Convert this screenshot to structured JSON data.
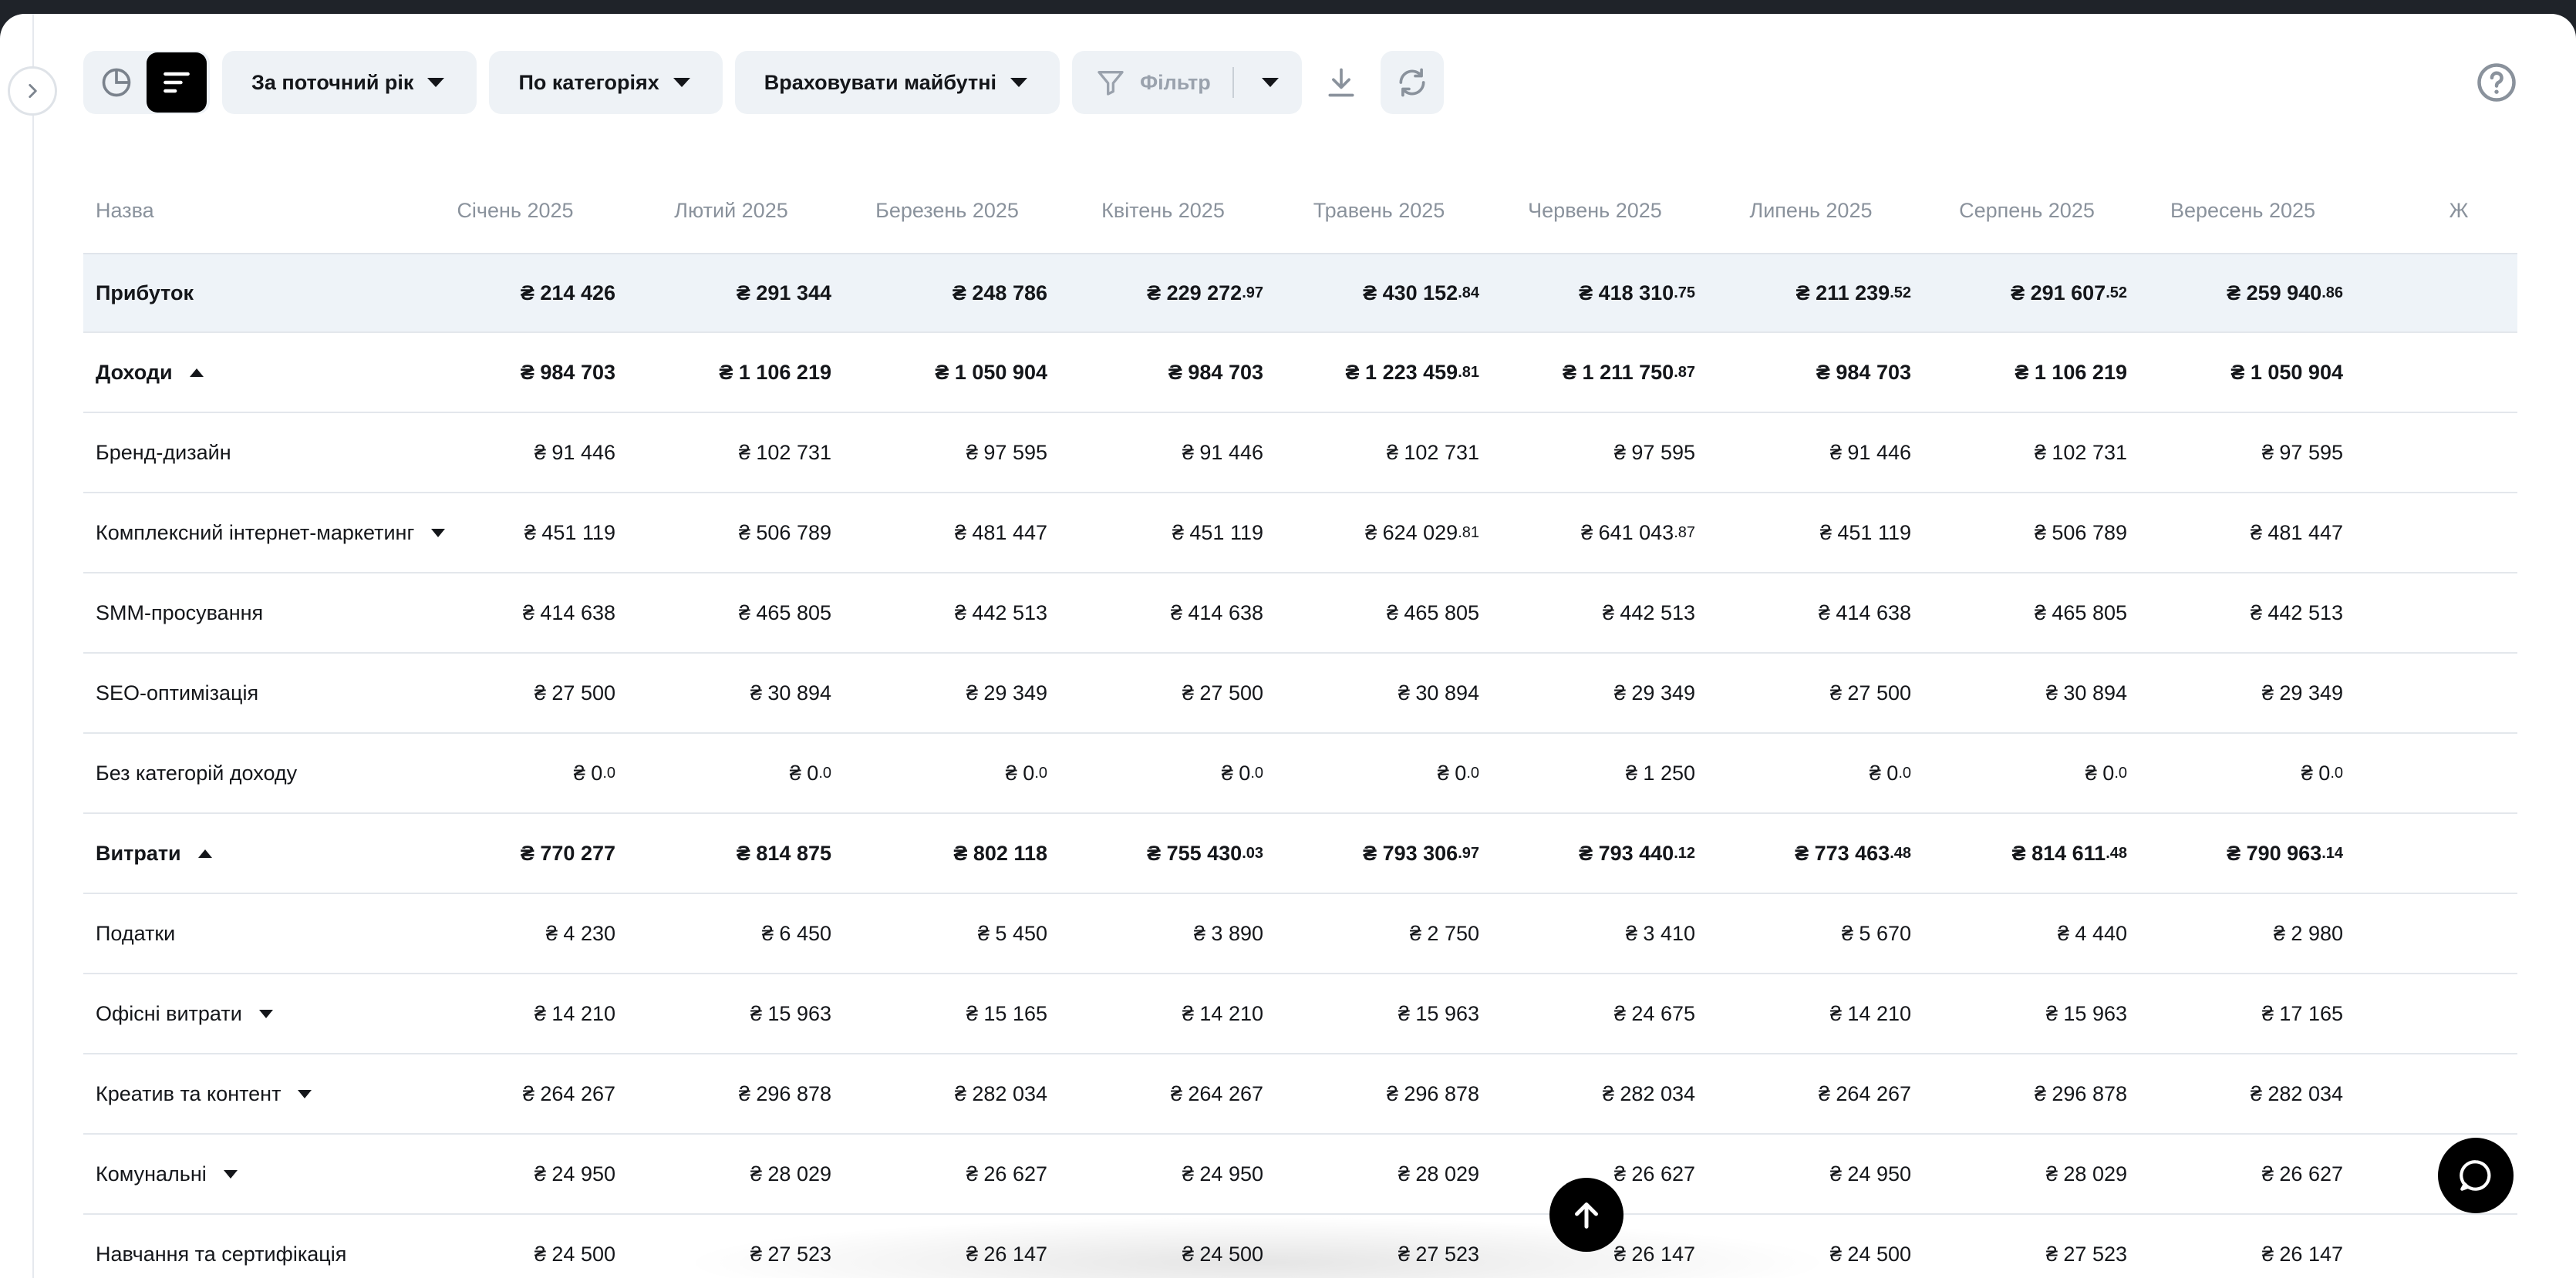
{
  "toolbar": {
    "period_label": "За поточний рік",
    "group_label": "По категоріях",
    "future_label": "Враховувати майбутні",
    "filter_label": "Фільтр"
  },
  "table": {
    "columns": [
      "Назва",
      "Січень 2025",
      "Лютий 2025",
      "Березень 2025",
      "Квітень 2025",
      "Травень 2025",
      "Червень 2025",
      "Липень 2025",
      "Серпень 2025",
      "Вересень 2025",
      "Ж"
    ],
    "rows": [
      {
        "name": "Прибуток",
        "bold": true,
        "profit": true,
        "toggle": "",
        "values": [
          [
            "₴ 214 426",
            ""
          ],
          [
            "₴ 291 344",
            ""
          ],
          [
            "₴ 248 786",
            ""
          ],
          [
            "₴ 229 272",
            ".97"
          ],
          [
            "₴ 430 152",
            ".84"
          ],
          [
            "₴ 418 310",
            ".75"
          ],
          [
            "₴ 211 239",
            ".52"
          ],
          [
            "₴ 291 607",
            ".52"
          ],
          [
            "₴ 259 940",
            ".86"
          ],
          [
            "₴",
            ""
          ]
        ]
      },
      {
        "name": "Доходи",
        "bold": true,
        "toggle": "up",
        "values": [
          [
            "₴ 984 703",
            ""
          ],
          [
            "₴ 1 106 219",
            ""
          ],
          [
            "₴ 1 050 904",
            ""
          ],
          [
            "₴ 984 703",
            ""
          ],
          [
            "₴ 1 223 459",
            ".81"
          ],
          [
            "₴ 1 211 750",
            ".87"
          ],
          [
            "₴ 984 703",
            ""
          ],
          [
            "₴ 1 106 219",
            ""
          ],
          [
            "₴ 1 050 904",
            ""
          ],
          [
            "",
            ""
          ]
        ]
      },
      {
        "name": "Бренд-дизайн",
        "toggle": "",
        "values": [
          [
            "₴ 91 446",
            ""
          ],
          [
            "₴ 102 731",
            ""
          ],
          [
            "₴ 97 595",
            ""
          ],
          [
            "₴ 91 446",
            ""
          ],
          [
            "₴ 102 731",
            ""
          ],
          [
            "₴ 97 595",
            ""
          ],
          [
            "₴ 91 446",
            ""
          ],
          [
            "₴ 102 731",
            ""
          ],
          [
            "₴ 97 595",
            ""
          ],
          [
            "",
            ""
          ]
        ]
      },
      {
        "name": "Комплексний інтернет-маркетинг",
        "toggle": "down",
        "values": [
          [
            "₴ 451 119",
            ""
          ],
          [
            "₴ 506 789",
            ""
          ],
          [
            "₴ 481 447",
            ""
          ],
          [
            "₴ 451 119",
            ""
          ],
          [
            "₴ 624 029",
            ".81"
          ],
          [
            "₴ 641 043",
            ".87"
          ],
          [
            "₴ 451 119",
            ""
          ],
          [
            "₴ 506 789",
            ""
          ],
          [
            "₴ 481 447",
            ""
          ],
          [
            "",
            ""
          ]
        ]
      },
      {
        "name": "SMM-просування",
        "toggle": "",
        "values": [
          [
            "₴ 414 638",
            ""
          ],
          [
            "₴ 465 805",
            ""
          ],
          [
            "₴ 442 513",
            ""
          ],
          [
            "₴ 414 638",
            ""
          ],
          [
            "₴ 465 805",
            ""
          ],
          [
            "₴ 442 513",
            ""
          ],
          [
            "₴ 414 638",
            ""
          ],
          [
            "₴ 465 805",
            ""
          ],
          [
            "₴ 442 513",
            ""
          ],
          [
            "",
            ""
          ]
        ]
      },
      {
        "name": "SEO-оптимізація",
        "toggle": "",
        "values": [
          [
            "₴ 27 500",
            ""
          ],
          [
            "₴ 30 894",
            ""
          ],
          [
            "₴ 29 349",
            ""
          ],
          [
            "₴ 27 500",
            ""
          ],
          [
            "₴ 30 894",
            ""
          ],
          [
            "₴ 29 349",
            ""
          ],
          [
            "₴ 27 500",
            ""
          ],
          [
            "₴ 30 894",
            ""
          ],
          [
            "₴ 29 349",
            ""
          ],
          [
            "",
            ""
          ]
        ]
      },
      {
        "name": "Без категорій доходу",
        "toggle": "",
        "values": [
          [
            "₴ 0",
            ".0"
          ],
          [
            "₴ 0",
            ".0"
          ],
          [
            "₴ 0",
            ".0"
          ],
          [
            "₴ 0",
            ".0"
          ],
          [
            "₴ 0",
            ".0"
          ],
          [
            "₴ 1 250",
            ""
          ],
          [
            "₴ 0",
            ".0"
          ],
          [
            "₴ 0",
            ".0"
          ],
          [
            "₴ 0",
            ".0"
          ],
          [
            "",
            ""
          ]
        ]
      },
      {
        "name": "Витрати",
        "bold": true,
        "toggle": "up",
        "values": [
          [
            "₴ 770 277",
            ""
          ],
          [
            "₴ 814 875",
            ""
          ],
          [
            "₴ 802 118",
            ""
          ],
          [
            "₴ 755 430",
            ".03"
          ],
          [
            "₴ 793 306",
            ".97"
          ],
          [
            "₴ 793 440",
            ".12"
          ],
          [
            "₴ 773 463",
            ".48"
          ],
          [
            "₴ 814 611",
            ".48"
          ],
          [
            "₴ 790 963",
            ".14"
          ],
          [
            "₴",
            ""
          ]
        ]
      },
      {
        "name": "Податки",
        "toggle": "",
        "values": [
          [
            "₴ 4 230",
            ""
          ],
          [
            "₴ 6 450",
            ""
          ],
          [
            "₴ 5 450",
            ""
          ],
          [
            "₴ 3 890",
            ""
          ],
          [
            "₴ 2 750",
            ""
          ],
          [
            "₴ 3 410",
            ""
          ],
          [
            "₴ 5 670",
            ""
          ],
          [
            "₴ 4 440",
            ""
          ],
          [
            "₴ 2 980",
            ""
          ],
          [
            "",
            ""
          ]
        ]
      },
      {
        "name": "Офісні витрати",
        "toggle": "down",
        "values": [
          [
            "₴ 14 210",
            ""
          ],
          [
            "₴ 15 963",
            ""
          ],
          [
            "₴ 15 165",
            ""
          ],
          [
            "₴ 14 210",
            ""
          ],
          [
            "₴ 15 963",
            ""
          ],
          [
            "₴ 24 675",
            ""
          ],
          [
            "₴ 14 210",
            ""
          ],
          [
            "₴ 15 963",
            ""
          ],
          [
            "₴ 17 165",
            ""
          ],
          [
            "",
            ""
          ]
        ]
      },
      {
        "name": "Креатив та контент",
        "toggle": "down",
        "values": [
          [
            "₴ 264 267",
            ""
          ],
          [
            "₴ 296 878",
            ""
          ],
          [
            "₴ 282 034",
            ""
          ],
          [
            "₴ 264 267",
            ""
          ],
          [
            "₴ 296 878",
            ""
          ],
          [
            "₴ 282 034",
            ""
          ],
          [
            "₴ 264 267",
            ""
          ],
          [
            "₴ 296 878",
            ""
          ],
          [
            "₴ 282 034",
            ""
          ],
          [
            "",
            ""
          ]
        ]
      },
      {
        "name": "Комунальні",
        "toggle": "down",
        "values": [
          [
            "₴ 24 950",
            ""
          ],
          [
            "₴ 28 029",
            ""
          ],
          [
            "₴ 26 627",
            ""
          ],
          [
            "₴ 24 950",
            ""
          ],
          [
            "₴ 28 029",
            ""
          ],
          [
            "₴ 26 627",
            ""
          ],
          [
            "₴ 24 950",
            ""
          ],
          [
            "₴ 28 029",
            ""
          ],
          [
            "₴ 26 627",
            ""
          ],
          [
            "",
            ""
          ]
        ]
      },
      {
        "name": "Навчання та сертифікація",
        "toggle": "",
        "values": [
          [
            "₴ 24 500",
            ""
          ],
          [
            "₴ 27 523",
            ""
          ],
          [
            "₴ 26 147",
            ""
          ],
          [
            "₴ 24 500",
            ""
          ],
          [
            "₴ 27 523",
            ""
          ],
          [
            "₴ 26 147",
            ""
          ],
          [
            "₴ 24 500",
            ""
          ],
          [
            "₴ 27 523",
            ""
          ],
          [
            "₴ 26 147",
            ""
          ],
          [
            "",
            ""
          ]
        ]
      }
    ]
  }
}
